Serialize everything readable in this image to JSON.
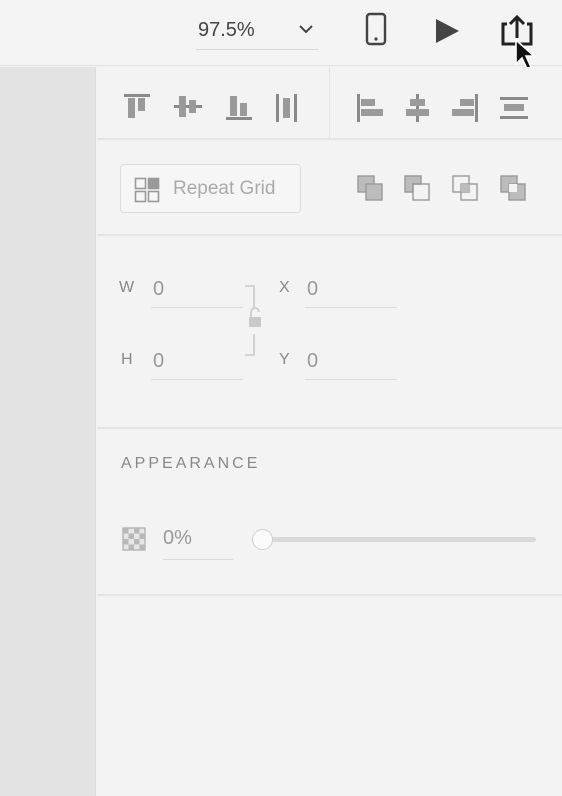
{
  "toolbar": {
    "zoom_value": "97.5%",
    "icons": [
      "chevron-down-icon",
      "mobile-device-icon",
      "play-icon",
      "share-icon",
      "mouse-cursor"
    ]
  },
  "align": {
    "icons": [
      "align-top-icon",
      "align-middle-icon",
      "align-bottom-icon",
      "distribute-vertical-icon",
      "align-left-icon",
      "align-center-icon",
      "align-right-icon",
      "distribute-horizontal-icon"
    ]
  },
  "repeat_grid": {
    "label": "Repeat Grid"
  },
  "boolean": {
    "icons": [
      "add-icon",
      "subtract-icon",
      "intersect-icon",
      "exclude-overlap-icon"
    ]
  },
  "transform": {
    "w_label": "W",
    "w_value": "0",
    "h_label": "H",
    "h_value": "0",
    "x_label": "X",
    "x_value": "0",
    "y_label": "Y",
    "y_value": "0"
  },
  "appearance": {
    "title": "APPEARANCE",
    "opacity_value": "0%",
    "opacity_fraction": 0
  },
  "colors": {
    "icon": "#8a8a8a",
    "panel": "#f3f3f3",
    "strip": "#e3e3e3"
  }
}
